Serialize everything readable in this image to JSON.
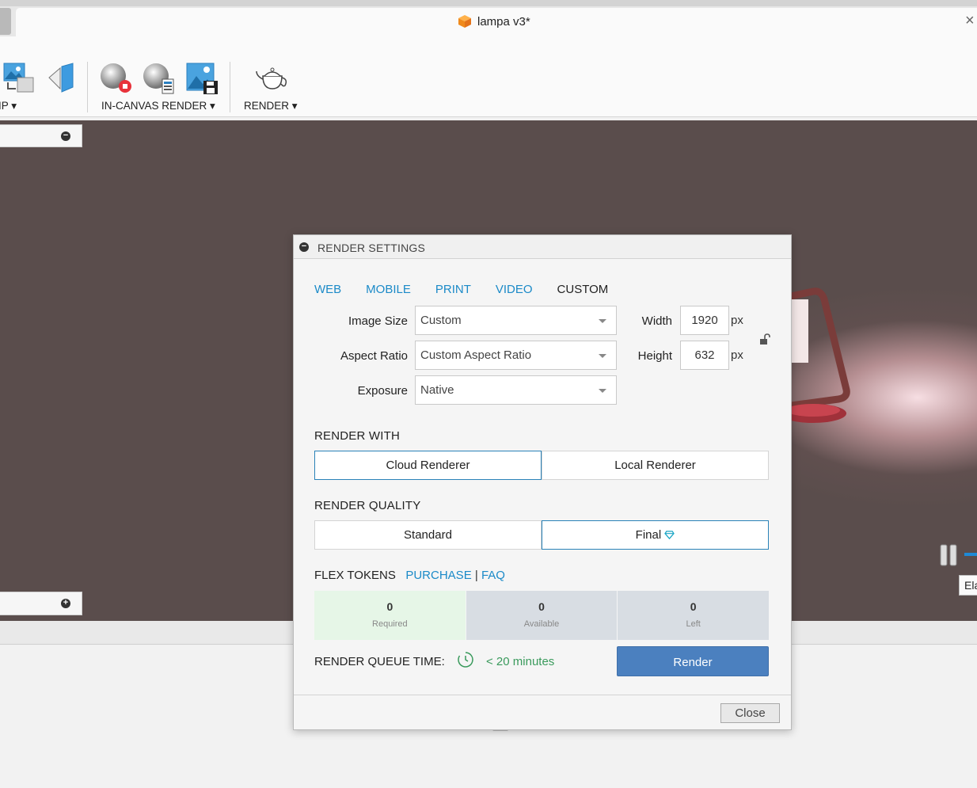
{
  "window": {
    "title": "lampa v3*",
    "close_glyph": "×"
  },
  "toolbar": {
    "groups": [
      {
        "label": "IP ▾",
        "icon": "setup-scene-icon"
      },
      {
        "label": "IN-CANVAS RENDER ▾",
        "icon": "in-canvas-render-icon"
      },
      {
        "label": "RENDER ▾",
        "icon": "render-teapot-icon"
      }
    ]
  },
  "viewport": {
    "overlay_label": "Ela"
  },
  "dialog": {
    "title": "RENDER SETTINGS",
    "tabs": [
      {
        "label": "WEB",
        "active": false
      },
      {
        "label": "MOBILE",
        "active": false
      },
      {
        "label": "PRINT",
        "active": false
      },
      {
        "label": "VIDEO",
        "active": false
      },
      {
        "label": "CUSTOM",
        "active": true
      }
    ],
    "image_size": {
      "label": "Image Size",
      "value": "Custom"
    },
    "aspect_ratio": {
      "label": "Aspect Ratio",
      "value": "Custom Aspect Ratio"
    },
    "exposure": {
      "label": "Exposure",
      "value": "Native"
    },
    "width": {
      "label": "Width",
      "value": "1920",
      "unit": "px"
    },
    "height": {
      "label": "Height",
      "value": "632",
      "unit": "px"
    },
    "render_with": {
      "label": "RENDER WITH",
      "options": [
        "Cloud Renderer",
        "Local Renderer"
      ],
      "selected": "Cloud Renderer"
    },
    "render_quality": {
      "label": "RENDER QUALITY",
      "options": [
        "Standard",
        "Final"
      ],
      "selected": "Final"
    },
    "flex_tokens": {
      "label": "FLEX TOKENS",
      "purchase": "PURCHASE",
      "separator": "|",
      "faq": "FAQ",
      "cells": [
        {
          "value": "0",
          "caption": "Required"
        },
        {
          "value": "0",
          "caption": "Available"
        },
        {
          "value": "0",
          "caption": "Left"
        }
      ]
    },
    "queue": {
      "label": "RENDER QUEUE TIME:",
      "time": "< 20 minutes"
    },
    "render_button": "Render",
    "close_button": "Close"
  },
  "colors": {
    "accent_blue": "#1b8ac8",
    "render_button": "#4b80bf",
    "queue_green": "#3a9a5c",
    "canvas_bg": "#5a4d4c"
  }
}
